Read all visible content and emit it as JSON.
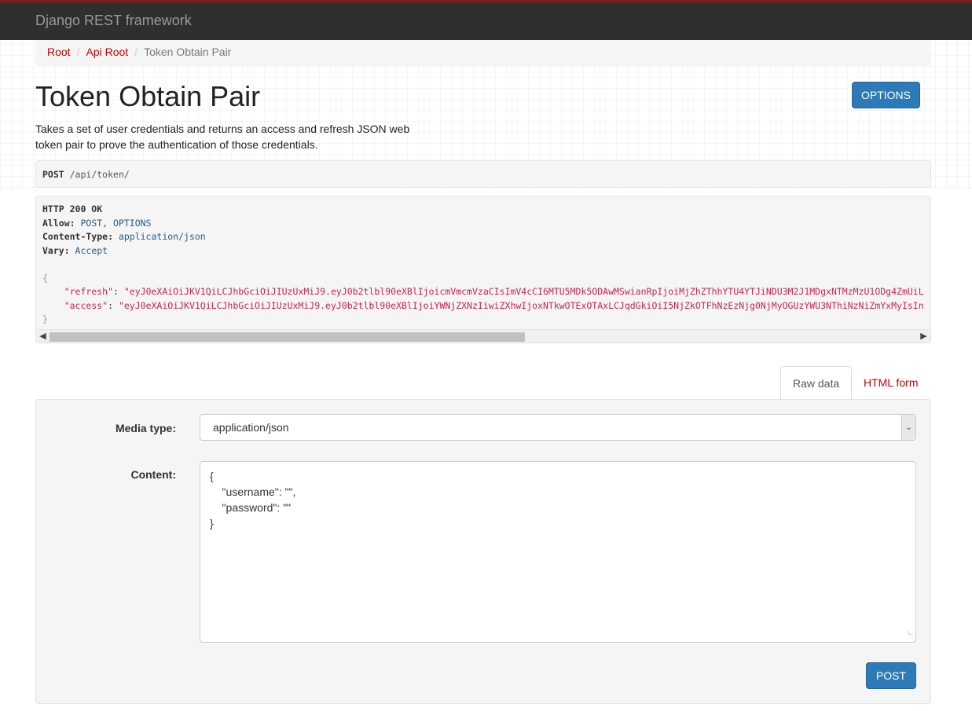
{
  "navbar": {
    "brand": "Django REST framework"
  },
  "breadcrumb": {
    "items": [
      {
        "label": "Root"
      },
      {
        "label": "Api Root"
      }
    ],
    "current": "Token Obtain Pair"
  },
  "page": {
    "title": "Token Obtain Pair",
    "description": "Takes a set of user credentials and returns an access and refresh JSON web token pair to prove the authentication of those credentials.",
    "options_label": "OPTIONS"
  },
  "request": {
    "method": "POST",
    "path": " /api/token/"
  },
  "response": {
    "status": "HTTP 200 OK",
    "headers": [
      {
        "name": "Allow:",
        "value": " POST, OPTIONS"
      },
      {
        "name": "Content-Type:",
        "value": " application/json"
      },
      {
        "name": "Vary:",
        "value": " Accept"
      }
    ],
    "body": {
      "open": "{",
      "refresh_key": "\"refresh\"",
      "refresh_value": "\"eyJ0eXAiOiJKV1QiLCJhbGciOiJIUzUxMiJ9.eyJ0b2tlbl90eXBlIjoicmVmcmVzaCIsImV4cCI6MTU5MDk5ODAwMSwianRpIjoiMjZhZThhYTU4YTJiNDU3M2J1MDgxNTMzMzU1ODg4ZmUiL",
      "access_key": "\"access\"",
      "access_value": "\"eyJ0eXAiOiJKV1QiLCJhbGciOiJIUzUxMiJ9.eyJ0b2tlbl90eXBlIjoiYWNjZXNzIiwiZXhwIjoxNTkwOTExOTAxLCJqdGkiOiI5NjZkOTFhNzEzNjg0NjMyOGUzYWU3NThiNzNiZmYxMyIsIn",
      "close": "}"
    }
  },
  "tabs": {
    "raw": "Raw data",
    "html": "HTML form"
  },
  "form": {
    "media_type_label": "Media type:",
    "media_type_value": "application/json",
    "content_label": "Content:",
    "content_value": "{\n    \"username\": \"\",\n    \"password\": \"\"\n}",
    "post_label": "POST"
  }
}
